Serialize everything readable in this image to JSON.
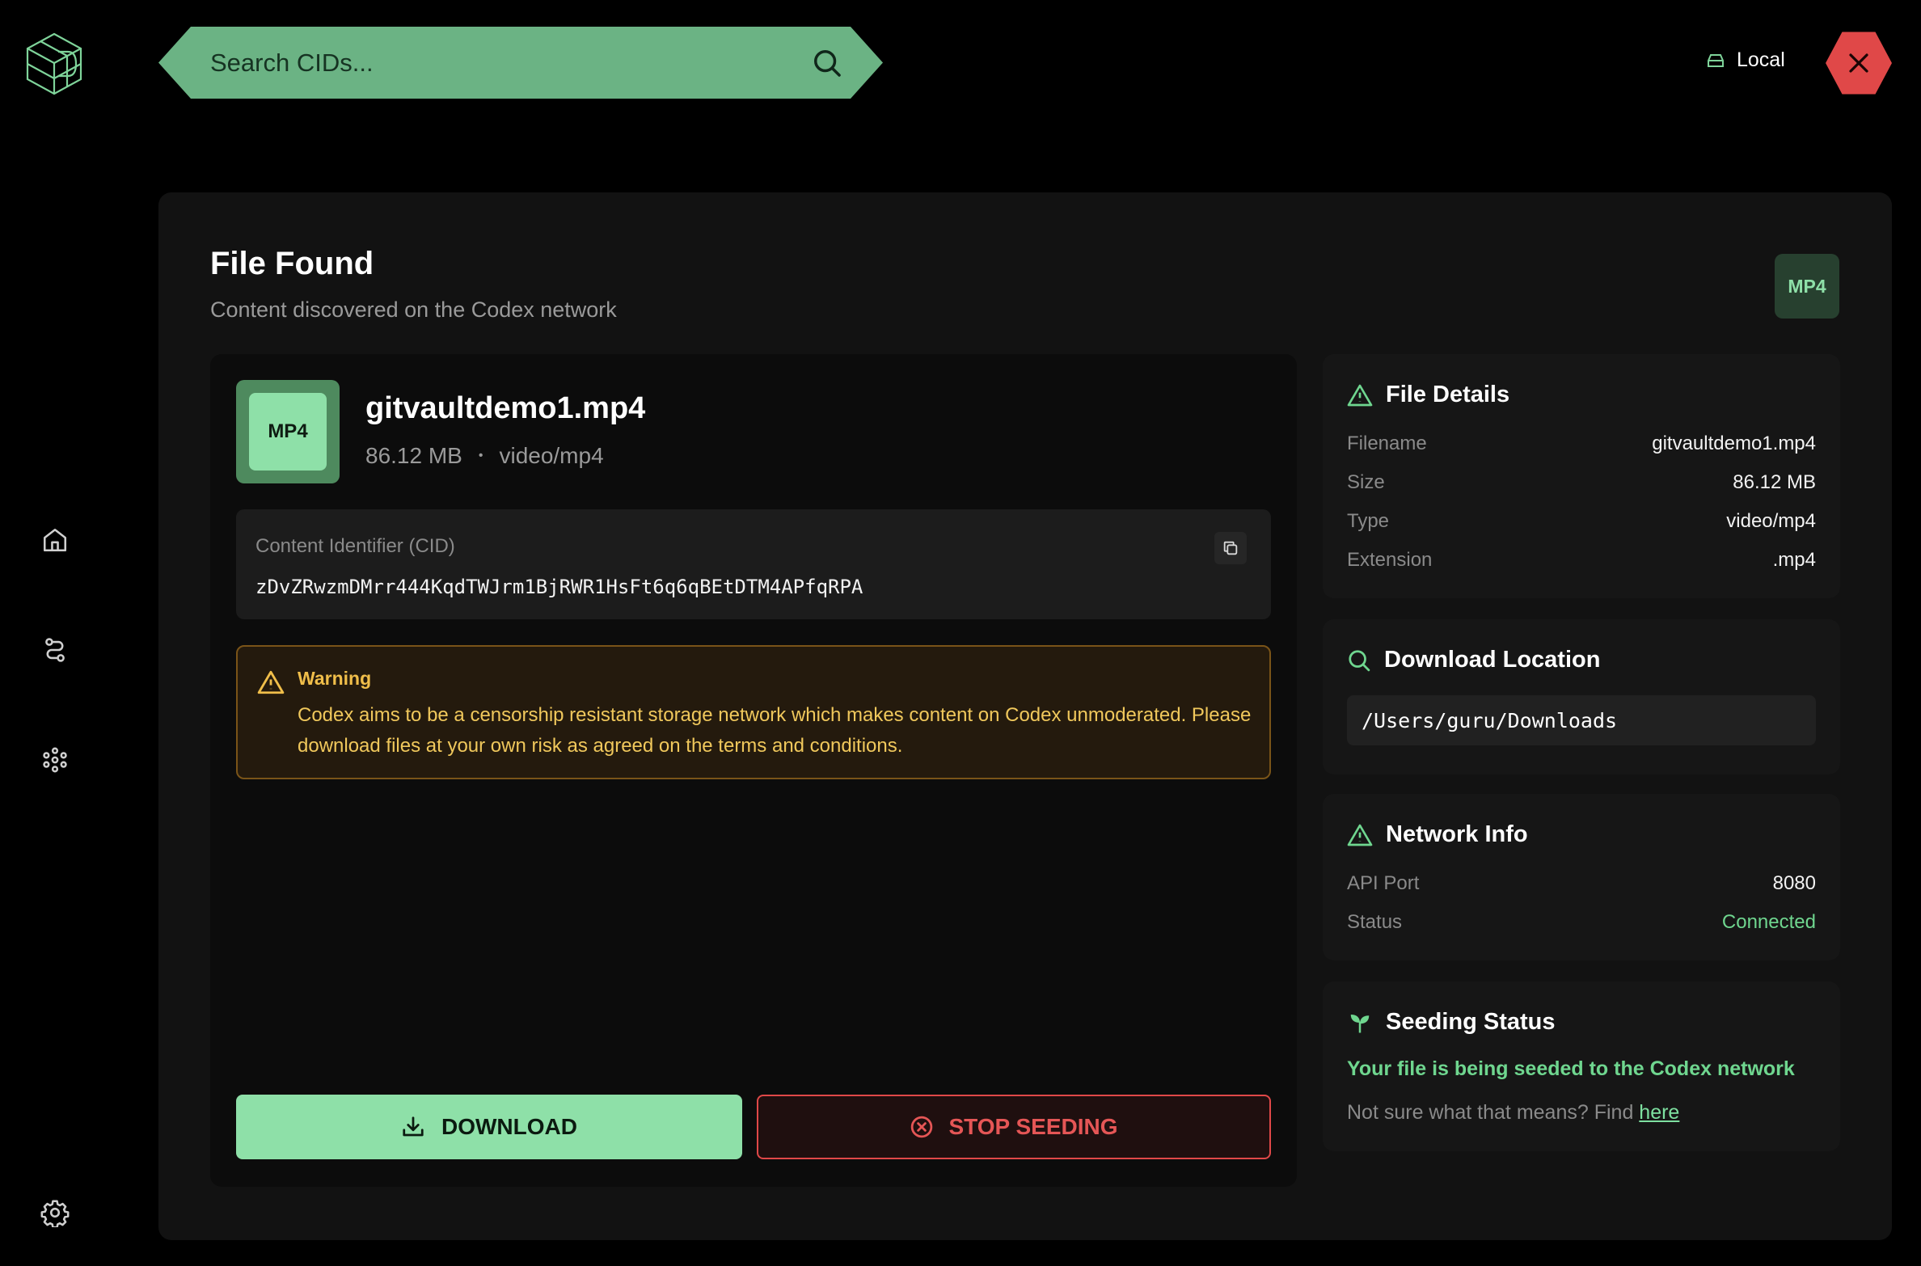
{
  "search": {
    "placeholder": "Search CIDs..."
  },
  "header": {
    "node_mode": "Local"
  },
  "page": {
    "title": "File Found",
    "subtitle": "Content discovered on the Codex network",
    "ext_badge": "MP4"
  },
  "file": {
    "thumb_label": "MP4",
    "name": "gitvaultdemo1.mp4",
    "size": "86.12 MB",
    "separator": "•",
    "mime": "video/mp4"
  },
  "cid": {
    "label": "Content Identifier (CID)",
    "value": "zDvZRwzmDMrr444KqdTWJrm1BjRWR1HsFt6q6qBEtDTM4APfqRPA"
  },
  "warning": {
    "title": "Warning",
    "text": "Codex aims to be a censorship resistant storage network which makes content on Codex unmoderated. Please download files at your own risk as agreed on the terms and conditions."
  },
  "actions": {
    "download": "DOWNLOAD",
    "stop_seeding": "STOP SEEDING"
  },
  "file_details": {
    "title": "File Details",
    "rows": [
      {
        "key": "Filename",
        "value": "gitvaultdemo1.mp4"
      },
      {
        "key": "Size",
        "value": "86.12 MB"
      },
      {
        "key": "Type",
        "value": "video/mp4"
      },
      {
        "key": "Extension",
        "value": ".mp4"
      }
    ]
  },
  "download_location": {
    "title": "Download Location",
    "path": "/Users/guru/Downloads"
  },
  "network_info": {
    "title": "Network Info",
    "rows": [
      {
        "key": "API Port",
        "value": "8080"
      },
      {
        "key": "Status",
        "value": "Connected"
      }
    ]
  },
  "seeding": {
    "title": "Seeding Status",
    "message": "Your file is being seeded to the Codex network",
    "help_prefix": "Not sure what that means? Find ",
    "help_link": "here"
  },
  "colors": {
    "accent_green": "#8ee0a8",
    "search_green": "#6bb384",
    "danger_red": "#e04848",
    "warning_amber": "#f0be4a",
    "panel_bg": "#121212"
  },
  "icons": {
    "logo": "codex-logo-icon",
    "nav": [
      "home-icon",
      "routes-icon",
      "peers-icon",
      "settings-icon"
    ],
    "search": "search-icon",
    "local": "drive-icon",
    "close": "close-icon"
  }
}
